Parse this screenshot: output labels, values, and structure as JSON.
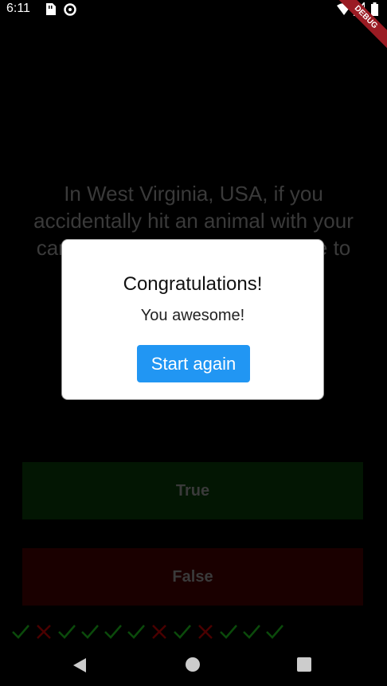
{
  "status_bar": {
    "time": "6:11",
    "debug_label": "DEBUG"
  },
  "quiz": {
    "question": "In West Virginia, USA, if you accidentally hit an animal with your car, you are free to take it home to eat.",
    "true_label": "True",
    "false_label": "False",
    "score_marks": [
      "check",
      "cross",
      "check",
      "check",
      "check",
      "check",
      "cross",
      "check",
      "cross",
      "check",
      "check",
      "check"
    ]
  },
  "dialog": {
    "title": "Congratulations!",
    "message": "You awesome!",
    "button_label": "Start again"
  },
  "colors": {
    "accent": "#2196f3",
    "check": "#0b4a0b",
    "cross": "#4a0000"
  }
}
